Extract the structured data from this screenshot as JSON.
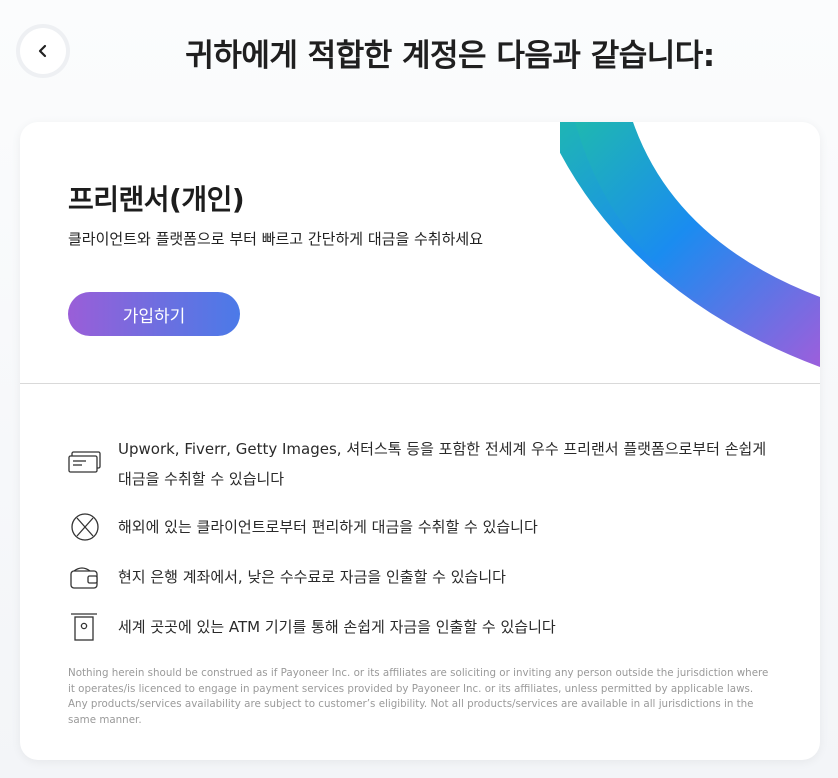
{
  "header": {
    "back_label": "back",
    "title": "귀하에게 적합한 계정은 다음과 같습니다:"
  },
  "card": {
    "title": "프리랜서(개인)",
    "subtitle": "클라이언트와 플랫폼으로 부터 빠르고 간단하게 대금을 수취하세요",
    "signup_label": "가입하기"
  },
  "features": [
    {
      "icon": "cards-icon",
      "text": "Upwork, Fiverr, Getty Images, 셔터스톡 등을 포함한 전세계 우수 프리랜서 플랫폼으로부터 손쉽게 대금을 수취할 수 있습니다"
    },
    {
      "icon": "globe-icon",
      "text": "해외에 있는 클라이언트로부터 편리하게 대금을 수취할 수 있습니다"
    },
    {
      "icon": "wallet-icon",
      "text": "현지 은행 계좌에서, 낮은 수수료로 자금을 인출할 수 있습니다"
    },
    {
      "icon": "atm-icon",
      "text": "세계 곳곳에 있는 ATM 기기를 통해 손쉽게 자금을 인출할 수 있습니다"
    }
  ],
  "disclaimer": "Nothing herein should be construed as if Payoneer Inc. or its affiliates are soliciting or inviting any person outside the jurisdiction where it operates/is licenced to engage in payment services provided by Payoneer Inc. or its affiliates, unless permitted by applicable laws. Any products/services availability are subject to customer’s eligibility. Not all products/services are available in all jurisdictions in the same manner.",
  "colors": {
    "arc_start": "#1fb8b0",
    "arc_mid": "#1a8cf0",
    "arc_end": "#9b5fdc",
    "button_start": "#9a5ed8",
    "button_end": "#4b7ae8"
  }
}
